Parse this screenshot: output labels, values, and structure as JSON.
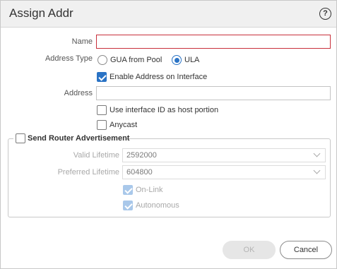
{
  "dialog": {
    "title": "Assign Addr",
    "help_glyph": "?"
  },
  "form": {
    "name": {
      "label": "Name",
      "value": ""
    },
    "address_type": {
      "label": "Address Type",
      "options": [
        {
          "label": "GUA from Pool",
          "selected": false
        },
        {
          "label": "ULA",
          "selected": true
        }
      ]
    },
    "enable_address": {
      "label": "Enable Address on Interface",
      "checked": true
    },
    "address": {
      "label": "Address",
      "value": ""
    },
    "use_interface_id": {
      "label": "Use interface ID as host portion",
      "checked": false
    },
    "anycast": {
      "label": "Anycast",
      "checked": false
    }
  },
  "router_advertisement": {
    "label": "Send Router Advertisement",
    "checked": false,
    "valid_lifetime": {
      "label": "Valid Lifetime",
      "value": "2592000"
    },
    "preferred_lifetime": {
      "label": "Preferred Lifetime",
      "value": "604800"
    },
    "on_link": {
      "label": "On-Link",
      "checked": true
    },
    "autonomous": {
      "label": "Autonomous",
      "checked": true
    }
  },
  "buttons": {
    "ok": "OK",
    "cancel": "Cancel"
  },
  "colors": {
    "accent": "#2a73c5",
    "error_border": "#c8303b"
  }
}
